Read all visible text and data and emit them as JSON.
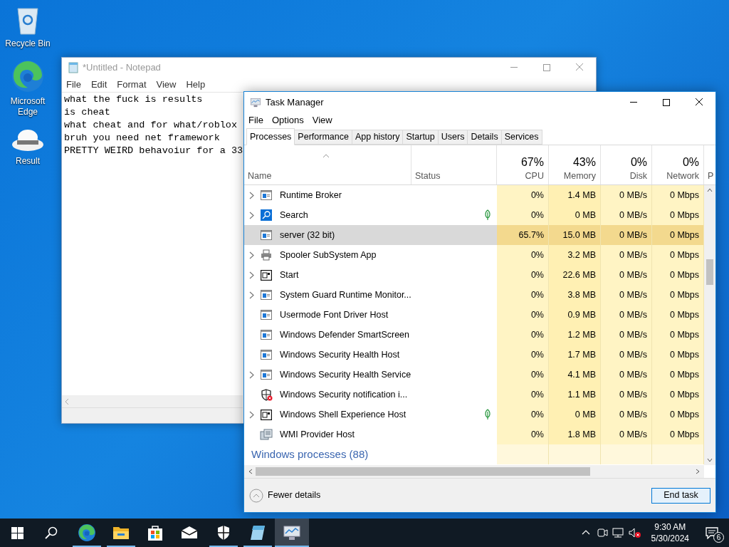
{
  "desktop_icons": [
    {
      "label": "Recycle Bin",
      "kind": "recycle"
    },
    {
      "label": "Microsoft Edge",
      "kind": "edge"
    },
    {
      "label": "Result",
      "kind": "cloud"
    }
  ],
  "notepad": {
    "title": "*Untitled - Notepad",
    "menu": [
      "File",
      "Edit",
      "Format",
      "View",
      "Help"
    ],
    "lines": [
      "what the fuck is results",
      "is cheat",
      "what cheat and for what/roblox",
      "bruh you need net framework",
      "PRETTY WEIRD behavoiur for a 33"
    ]
  },
  "task_manager": {
    "title": "Task Manager",
    "menu": [
      "File",
      "Options",
      "View"
    ],
    "tabs": [
      {
        "label": "Processes",
        "selected": true
      },
      {
        "label": "Performance",
        "selected": false
      },
      {
        "label": "App history",
        "selected": false
      },
      {
        "label": "Startup",
        "selected": false
      },
      {
        "label": "Users",
        "selected": false
      },
      {
        "label": "Details",
        "selected": false
      },
      {
        "label": "Services",
        "selected": false
      }
    ],
    "columns": [
      {
        "label": "Name"
      },
      {
        "label": "Status"
      },
      {
        "percent": "67%",
        "label": "CPU"
      },
      {
        "percent": "43%",
        "label": "Memory"
      },
      {
        "percent": "0%",
        "label": "Disk"
      },
      {
        "percent": "0%",
        "label": "Network"
      },
      {
        "label": "P"
      }
    ],
    "rows": [
      {
        "name": "Runtime Broker",
        "kind": "app",
        "expandable": true,
        "eco": false,
        "selected": false,
        "cpu": "0%",
        "memory": "1.4 MB",
        "disk": "0 MB/s",
        "network": "0 Mbps"
      },
      {
        "name": "Search",
        "kind": "search",
        "expandable": true,
        "eco": true,
        "selected": false,
        "cpu": "0%",
        "memory": "0 MB",
        "disk": "0 MB/s",
        "network": "0 Mbps"
      },
      {
        "name": "server (32 bit)",
        "kind": "app",
        "expandable": false,
        "eco": false,
        "selected": true,
        "cpu": "65.7%",
        "memory": "15.0 MB",
        "disk": "0 MB/s",
        "network": "0 Mbps"
      },
      {
        "name": "Spooler SubSystem App",
        "kind": "printer",
        "expandable": true,
        "eco": false,
        "selected": false,
        "cpu": "0%",
        "memory": "3.2 MB",
        "disk": "0 MB/s",
        "network": "0 Mbps"
      },
      {
        "name": "Start",
        "kind": "start",
        "expandable": true,
        "eco": false,
        "selected": false,
        "cpu": "0%",
        "memory": "22.6 MB",
        "disk": "0 MB/s",
        "network": "0 Mbps"
      },
      {
        "name": "System Guard Runtime Monitor...",
        "kind": "app",
        "expandable": true,
        "eco": false,
        "selected": false,
        "cpu": "0%",
        "memory": "3.8 MB",
        "disk": "0 MB/s",
        "network": "0 Mbps"
      },
      {
        "name": "Usermode Font Driver Host",
        "kind": "app",
        "expandable": false,
        "eco": false,
        "selected": false,
        "cpu": "0%",
        "memory": "0.9 MB",
        "disk": "0 MB/s",
        "network": "0 Mbps"
      },
      {
        "name": "Windows Defender SmartScreen",
        "kind": "app",
        "expandable": false,
        "eco": false,
        "selected": false,
        "cpu": "0%",
        "memory": "1.2 MB",
        "disk": "0 MB/s",
        "network": "0 Mbps"
      },
      {
        "name": "Windows Security Health Host",
        "kind": "app",
        "expandable": false,
        "eco": false,
        "selected": false,
        "cpu": "0%",
        "memory": "1.7 MB",
        "disk": "0 MB/s",
        "network": "0 Mbps"
      },
      {
        "name": "Windows Security Health Service",
        "kind": "app",
        "expandable": true,
        "eco": false,
        "selected": false,
        "cpu": "0%",
        "memory": "4.1 MB",
        "disk": "0 MB/s",
        "network": "0 Mbps"
      },
      {
        "name": "Windows Security notification i...",
        "kind": "shield",
        "expandable": false,
        "eco": false,
        "selected": false,
        "cpu": "0%",
        "memory": "1.1 MB",
        "disk": "0 MB/s",
        "network": "0 Mbps"
      },
      {
        "name": "Windows Shell Experience Host",
        "kind": "start",
        "expandable": true,
        "eco": true,
        "selected": false,
        "cpu": "0%",
        "memory": "0 MB",
        "disk": "0 MB/s",
        "network": "0 Mbps"
      },
      {
        "name": "WMI Provider Host",
        "kind": "wmi",
        "expandable": false,
        "eco": false,
        "selected": false,
        "cpu": "0%",
        "memory": "1.8 MB",
        "disk": "0 MB/s",
        "network": "0 Mbps"
      }
    ],
    "group": "Windows processes (88)",
    "footer": {
      "toggle": "Fewer details",
      "button": "End task"
    }
  },
  "taskbar": {
    "apps": [
      {
        "kind": "start",
        "running": false,
        "active": false
      },
      {
        "kind": "search",
        "running": false,
        "active": false
      },
      {
        "kind": "edge",
        "running": true,
        "active": false
      },
      {
        "kind": "folder",
        "running": true,
        "active": false
      },
      {
        "kind": "store",
        "running": false,
        "active": false
      },
      {
        "kind": "mail",
        "running": false,
        "active": false
      },
      {
        "kind": "security",
        "running": true,
        "active": false
      },
      {
        "kind": "notepad",
        "running": true,
        "active": false
      },
      {
        "kind": "taskmgr",
        "running": true,
        "active": true
      }
    ],
    "time": "9:30 AM",
    "date": "5/30/2024",
    "notifications": "6"
  }
}
